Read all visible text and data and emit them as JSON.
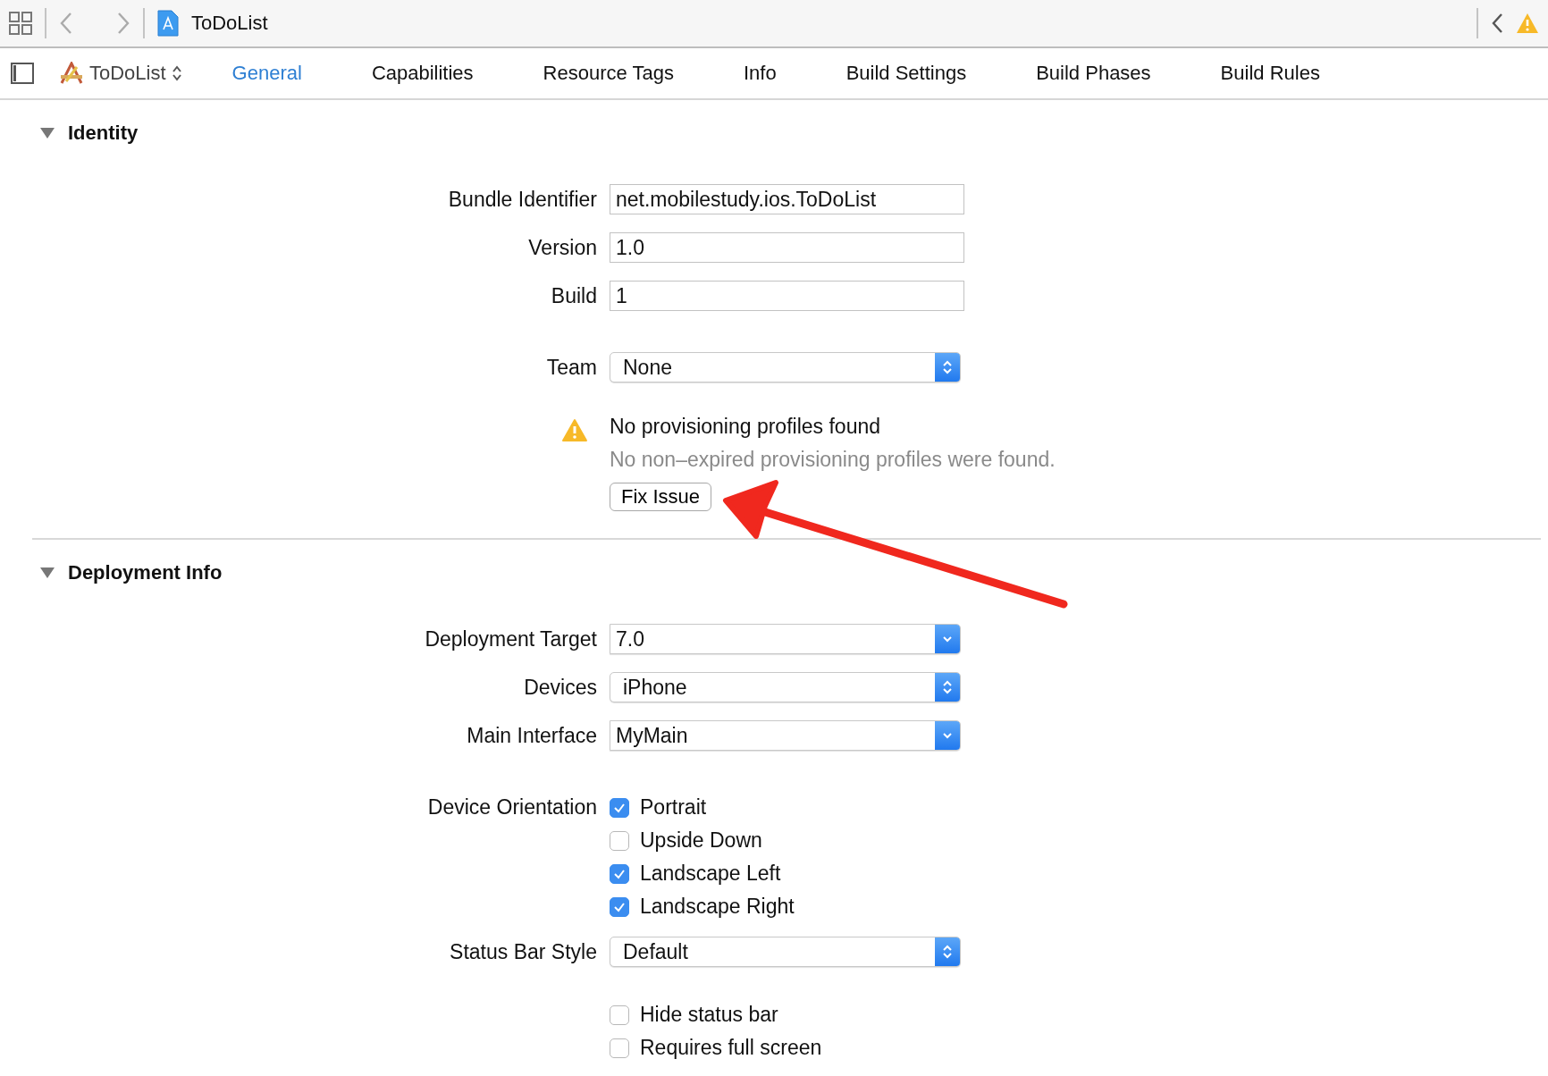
{
  "toolbar": {
    "title": "ToDoList"
  },
  "tab_bar": {
    "target": "ToDoList",
    "tabs": [
      {
        "label": "General",
        "selected": true
      },
      {
        "label": "Capabilities",
        "selected": false
      },
      {
        "label": "Resource Tags",
        "selected": false
      },
      {
        "label": "Info",
        "selected": false
      },
      {
        "label": "Build Settings",
        "selected": false
      },
      {
        "label": "Build Phases",
        "selected": false
      },
      {
        "label": "Build Rules",
        "selected": false
      }
    ]
  },
  "sections": [
    {
      "title": "Identity",
      "expanded": true,
      "fields": [
        {
          "kind": "text",
          "label": "Bundle Identifier",
          "value": "net.mobilestudy.ios.ToDoList"
        },
        {
          "kind": "text",
          "label": "Version",
          "value": "1.0"
        },
        {
          "kind": "text",
          "label": "Build",
          "value": "1"
        },
        {
          "kind": "popup",
          "label": "Team",
          "value": "None"
        }
      ],
      "issue": {
        "title": "No provisioning profiles found",
        "detail": "No non–expired provisioning profiles were found.",
        "button": "Fix Issue"
      }
    },
    {
      "title": "Deployment Info",
      "expanded": true,
      "fields": [
        {
          "kind": "combo",
          "label": "Deployment Target",
          "value": "7.0"
        },
        {
          "kind": "popup",
          "label": "Devices",
          "value": "iPhone"
        },
        {
          "kind": "combo",
          "label": "Main Interface",
          "value": "MyMain"
        },
        {
          "kind": "checkboxes",
          "label": "Device Orientation",
          "options": [
            {
              "label": "Portrait",
              "checked": true
            },
            {
              "label": "Upside Down",
              "checked": false
            },
            {
              "label": "Landscape Left",
              "checked": true
            },
            {
              "label": "Landscape Right",
              "checked": true
            }
          ]
        },
        {
          "kind": "popup",
          "label": "Status Bar Style",
          "value": "Default"
        },
        {
          "kind": "checkboxes",
          "options": [
            {
              "label": "Hide status bar",
              "checked": false
            },
            {
              "label": "Requires full screen",
              "checked": false
            }
          ]
        }
      ]
    }
  ]
}
